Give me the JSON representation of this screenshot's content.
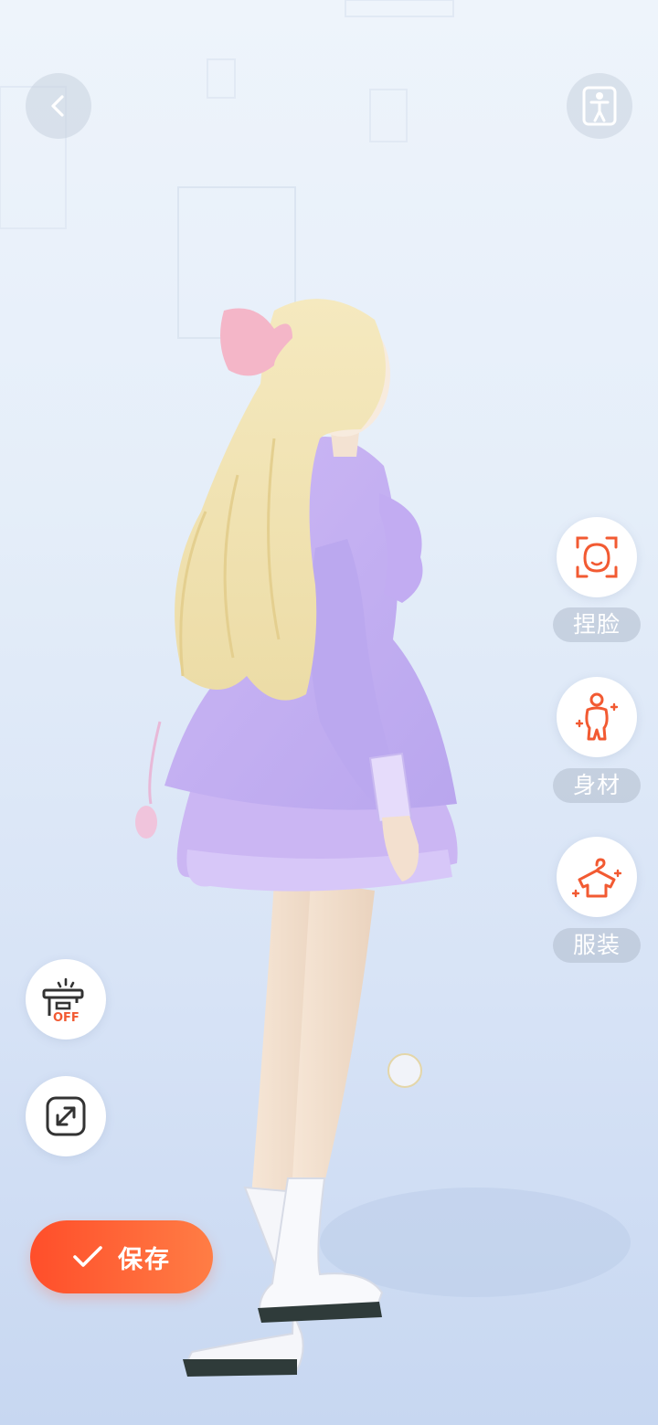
{
  "nav": {
    "back_icon": "chevron-left-icon",
    "pose_icon": "person-standing-icon"
  },
  "side_menu": [
    {
      "label": "捏脸",
      "icon": "face-scan-icon"
    },
    {
      "label": "身材",
      "icon": "body-figure-icon"
    },
    {
      "label": "服装",
      "icon": "clothes-hanger-icon"
    }
  ],
  "tools": {
    "stage_badge": "OFF",
    "stage_icon": "stage-light-icon",
    "fullscreen_icon": "expand-icon"
  },
  "save_button": {
    "label": "保存",
    "icon": "check-icon"
  },
  "colors": {
    "accent_start": "#ff4e2a",
    "accent_end": "#ff7d45",
    "icon_orange": "#f25a32"
  }
}
